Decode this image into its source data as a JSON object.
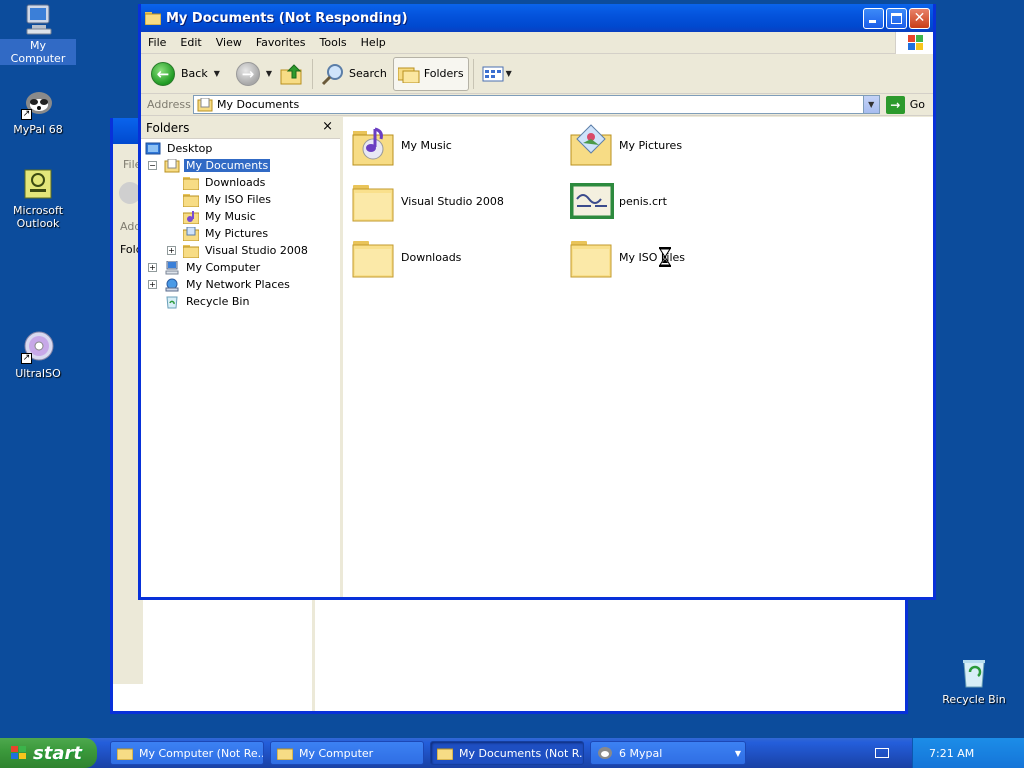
{
  "desktop": {
    "icons": [
      {
        "label": "My Computer"
      },
      {
        "label": "MyPal 68"
      },
      {
        "label": "Microsoft Outlook"
      },
      {
        "label": "UltraISO"
      },
      {
        "label": "Recycle Bin"
      }
    ]
  },
  "background_window": {
    "fragments": [
      "File",
      "Add",
      "Fold"
    ]
  },
  "window": {
    "title": "My Documents (Not Responding)",
    "menu": [
      "File",
      "Edit",
      "View",
      "Favorites",
      "Tools",
      "Help"
    ],
    "toolbar": {
      "back": "Back",
      "search": "Search",
      "folders": "Folders"
    },
    "address": {
      "label": "Address",
      "value": "My Documents",
      "go": "Go"
    },
    "folders_pane": {
      "title": "Folders",
      "close_glyph": "×",
      "tree": [
        {
          "label": "Desktop",
          "level": 0,
          "expander": ""
        },
        {
          "label": "My Documents",
          "level": 1,
          "expander": "−",
          "selected": true
        },
        {
          "label": "Downloads",
          "level": 2,
          "expander": ""
        },
        {
          "label": "My ISO Files",
          "level": 2,
          "expander": ""
        },
        {
          "label": "My Music",
          "level": 2,
          "expander": ""
        },
        {
          "label": "My Pictures",
          "level": 2,
          "expander": ""
        },
        {
          "label": "Visual Studio 2008",
          "level": 2,
          "expander": "+"
        },
        {
          "label": "My Computer",
          "level": 1,
          "expander": "+"
        },
        {
          "label": "My Network Places",
          "level": 1,
          "expander": "+"
        },
        {
          "label": "Recycle Bin",
          "level": 1,
          "expander": ""
        }
      ]
    },
    "items": [
      {
        "name": "My Music",
        "icon": "music-folder-icon"
      },
      {
        "name": "My Pictures",
        "icon": "pictures-folder-icon"
      },
      {
        "name": "Visual Studio 2008",
        "icon": "folder-icon"
      },
      {
        "name": "penis.crt",
        "icon": "certificate-icon"
      },
      {
        "name": "Downloads",
        "icon": "folder-icon"
      },
      {
        "name": "My ISO Files",
        "icon": "folder-icon"
      }
    ]
  },
  "taskbar": {
    "start": "start",
    "tasks": [
      {
        "label": "My Computer (Not Re..."
      },
      {
        "label": "My Computer"
      },
      {
        "label": "My Documents (Not R..."
      },
      {
        "label": "6 Mypal"
      }
    ],
    "clock": "7:21 AM"
  }
}
